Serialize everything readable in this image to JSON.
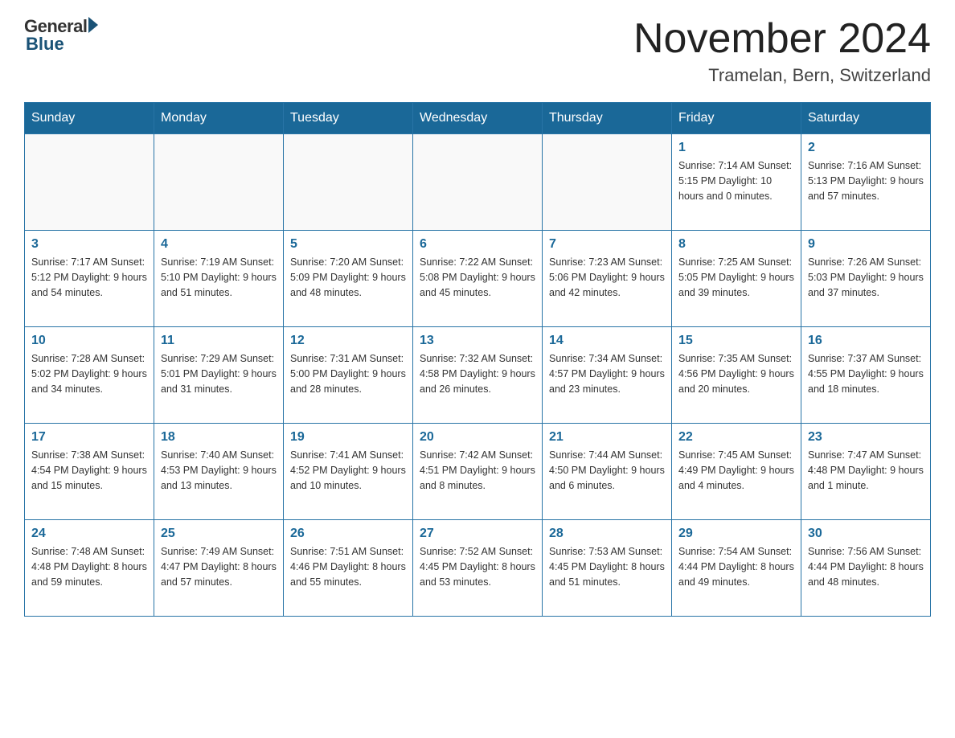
{
  "header": {
    "logo_general": "General",
    "logo_blue": "Blue",
    "title": "November 2024",
    "location": "Tramelan, Bern, Switzerland"
  },
  "days_of_week": [
    "Sunday",
    "Monday",
    "Tuesday",
    "Wednesday",
    "Thursday",
    "Friday",
    "Saturday"
  ],
  "weeks": [
    [
      {
        "day": "",
        "info": ""
      },
      {
        "day": "",
        "info": ""
      },
      {
        "day": "",
        "info": ""
      },
      {
        "day": "",
        "info": ""
      },
      {
        "day": "",
        "info": ""
      },
      {
        "day": "1",
        "info": "Sunrise: 7:14 AM\nSunset: 5:15 PM\nDaylight: 10 hours and 0 minutes."
      },
      {
        "day": "2",
        "info": "Sunrise: 7:16 AM\nSunset: 5:13 PM\nDaylight: 9 hours and 57 minutes."
      }
    ],
    [
      {
        "day": "3",
        "info": "Sunrise: 7:17 AM\nSunset: 5:12 PM\nDaylight: 9 hours and 54 minutes."
      },
      {
        "day": "4",
        "info": "Sunrise: 7:19 AM\nSunset: 5:10 PM\nDaylight: 9 hours and 51 minutes."
      },
      {
        "day": "5",
        "info": "Sunrise: 7:20 AM\nSunset: 5:09 PM\nDaylight: 9 hours and 48 minutes."
      },
      {
        "day": "6",
        "info": "Sunrise: 7:22 AM\nSunset: 5:08 PM\nDaylight: 9 hours and 45 minutes."
      },
      {
        "day": "7",
        "info": "Sunrise: 7:23 AM\nSunset: 5:06 PM\nDaylight: 9 hours and 42 minutes."
      },
      {
        "day": "8",
        "info": "Sunrise: 7:25 AM\nSunset: 5:05 PM\nDaylight: 9 hours and 39 minutes."
      },
      {
        "day": "9",
        "info": "Sunrise: 7:26 AM\nSunset: 5:03 PM\nDaylight: 9 hours and 37 minutes."
      }
    ],
    [
      {
        "day": "10",
        "info": "Sunrise: 7:28 AM\nSunset: 5:02 PM\nDaylight: 9 hours and 34 minutes."
      },
      {
        "day": "11",
        "info": "Sunrise: 7:29 AM\nSunset: 5:01 PM\nDaylight: 9 hours and 31 minutes."
      },
      {
        "day": "12",
        "info": "Sunrise: 7:31 AM\nSunset: 5:00 PM\nDaylight: 9 hours and 28 minutes."
      },
      {
        "day": "13",
        "info": "Sunrise: 7:32 AM\nSunset: 4:58 PM\nDaylight: 9 hours and 26 minutes."
      },
      {
        "day": "14",
        "info": "Sunrise: 7:34 AM\nSunset: 4:57 PM\nDaylight: 9 hours and 23 minutes."
      },
      {
        "day": "15",
        "info": "Sunrise: 7:35 AM\nSunset: 4:56 PM\nDaylight: 9 hours and 20 minutes."
      },
      {
        "day": "16",
        "info": "Sunrise: 7:37 AM\nSunset: 4:55 PM\nDaylight: 9 hours and 18 minutes."
      }
    ],
    [
      {
        "day": "17",
        "info": "Sunrise: 7:38 AM\nSunset: 4:54 PM\nDaylight: 9 hours and 15 minutes."
      },
      {
        "day": "18",
        "info": "Sunrise: 7:40 AM\nSunset: 4:53 PM\nDaylight: 9 hours and 13 minutes."
      },
      {
        "day": "19",
        "info": "Sunrise: 7:41 AM\nSunset: 4:52 PM\nDaylight: 9 hours and 10 minutes."
      },
      {
        "day": "20",
        "info": "Sunrise: 7:42 AM\nSunset: 4:51 PM\nDaylight: 9 hours and 8 minutes."
      },
      {
        "day": "21",
        "info": "Sunrise: 7:44 AM\nSunset: 4:50 PM\nDaylight: 9 hours and 6 minutes."
      },
      {
        "day": "22",
        "info": "Sunrise: 7:45 AM\nSunset: 4:49 PM\nDaylight: 9 hours and 4 minutes."
      },
      {
        "day": "23",
        "info": "Sunrise: 7:47 AM\nSunset: 4:48 PM\nDaylight: 9 hours and 1 minute."
      }
    ],
    [
      {
        "day": "24",
        "info": "Sunrise: 7:48 AM\nSunset: 4:48 PM\nDaylight: 8 hours and 59 minutes."
      },
      {
        "day": "25",
        "info": "Sunrise: 7:49 AM\nSunset: 4:47 PM\nDaylight: 8 hours and 57 minutes."
      },
      {
        "day": "26",
        "info": "Sunrise: 7:51 AM\nSunset: 4:46 PM\nDaylight: 8 hours and 55 minutes."
      },
      {
        "day": "27",
        "info": "Sunrise: 7:52 AM\nSunset: 4:45 PM\nDaylight: 8 hours and 53 minutes."
      },
      {
        "day": "28",
        "info": "Sunrise: 7:53 AM\nSunset: 4:45 PM\nDaylight: 8 hours and 51 minutes."
      },
      {
        "day": "29",
        "info": "Sunrise: 7:54 AM\nSunset: 4:44 PM\nDaylight: 8 hours and 49 minutes."
      },
      {
        "day": "30",
        "info": "Sunrise: 7:56 AM\nSunset: 4:44 PM\nDaylight: 8 hours and 48 minutes."
      }
    ]
  ]
}
